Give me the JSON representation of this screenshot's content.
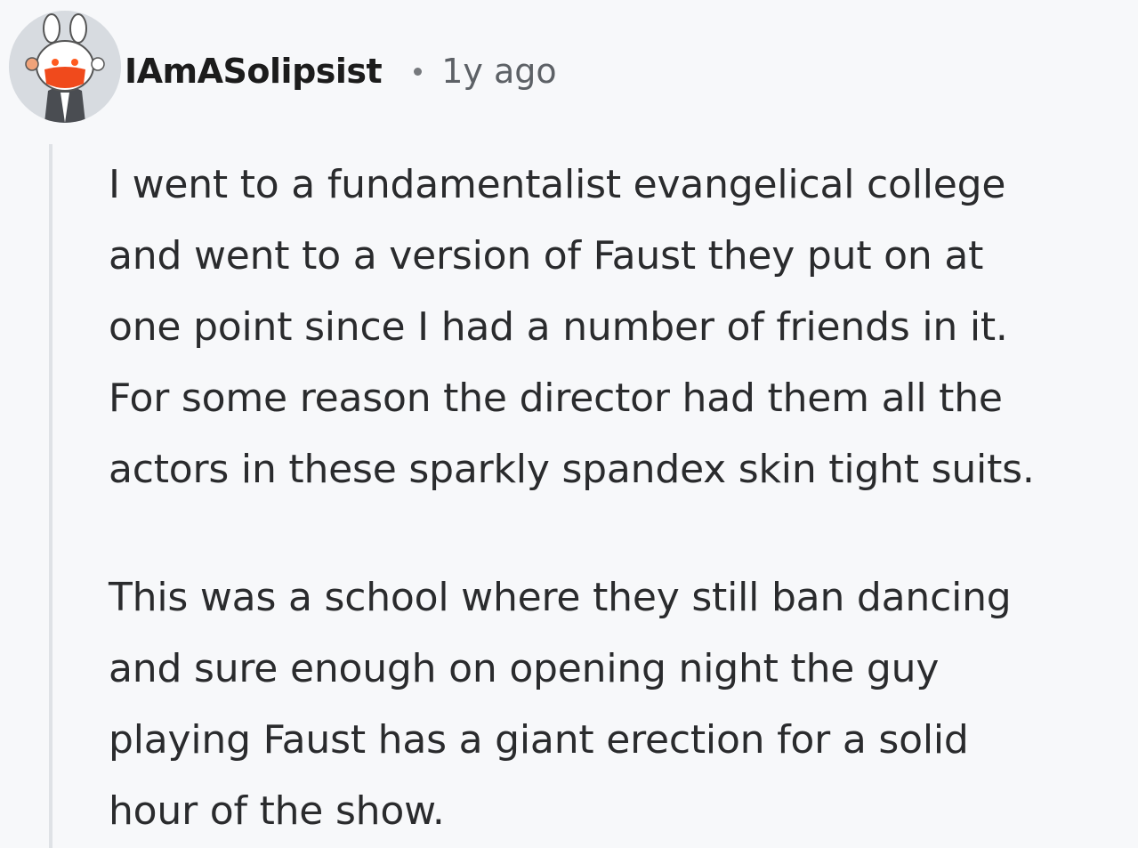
{
  "comment": {
    "username": "IAmASolipsist",
    "separator": "•",
    "timestamp": "1y ago",
    "avatar_icon": "snoo-avatar-icon",
    "paragraphs": [
      {
        "lines": [
          "I went to a fundamentalist evangelical college",
          "and went to a version of Faust they put on at",
          "one point since I had a number of friends in it.",
          "For some reason the director had them all the",
          "actors in these sparkly spandex skin tight suits."
        ]
      },
      {
        "lines": [
          "This was a school where they still ban dancing",
          "and sure enough on opening night the guy",
          "playing Faust has a giant erection for a solid",
          "hour of the show."
        ]
      }
    ]
  },
  "colors": {
    "background": "#f7f8fa",
    "username": "#1c1c1c",
    "timestamp": "#5d6166",
    "body_text": "#2a2b2d",
    "thread_line": "#dfe2e6",
    "avatar_mask": "#f04a1c"
  }
}
